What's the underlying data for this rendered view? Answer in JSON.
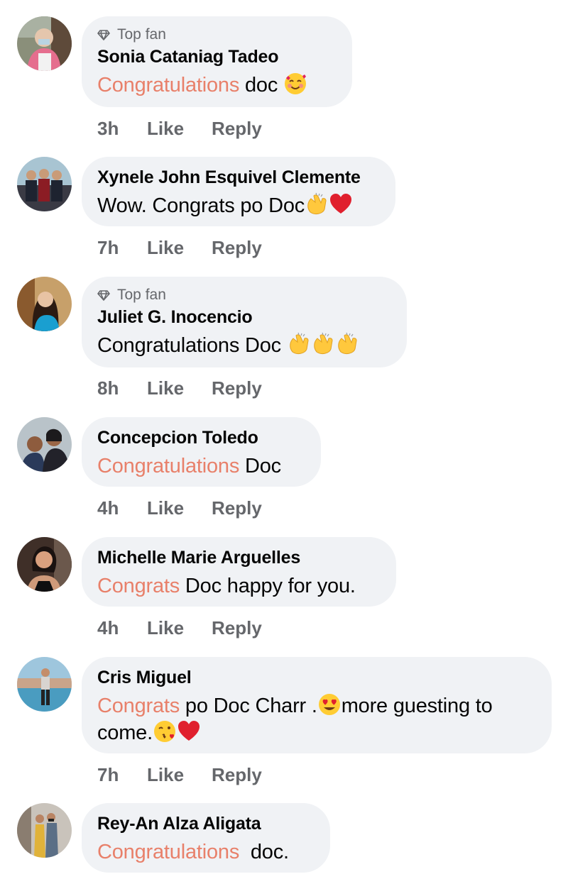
{
  "comments": [
    {
      "badge": "Top fan",
      "author": "Sonia Cataniag Tadeo",
      "highlight": "Congratulations",
      "text": " doc ",
      "emojis": [
        "smiling-face-with-hearts-emoji"
      ],
      "time": "3h",
      "like": "Like",
      "reply": "Reply"
    },
    {
      "author": "Xynele John Esquivel Clemente",
      "text": "Wow. Congrats po Doc",
      "emojis": [
        "clapping-hands-emoji",
        "red-heart-emoji"
      ],
      "time": "7h",
      "like": "Like",
      "reply": "Reply"
    },
    {
      "badge": "Top fan",
      "author": "Juliet G. Inocencio",
      "text": "Congratulations Doc ",
      "emojis": [
        "clapping-hands-emoji",
        "clapping-hands-emoji",
        "clapping-hands-emoji"
      ],
      "time": "8h",
      "like": "Like",
      "reply": "Reply"
    },
    {
      "author": "Concepcion Toledo",
      "highlight": "Congratulations",
      "text": " Doc",
      "time": "4h",
      "like": "Like",
      "reply": "Reply"
    },
    {
      "author": "Michelle Marie Arguelles",
      "highlight": "Congrats",
      "text": " Doc happy for you.",
      "time": "4h",
      "like": "Like",
      "reply": "Reply"
    },
    {
      "author": "Cris Miguel",
      "highlight": "Congrats",
      "text": " po Doc Charr .",
      "emoji_mid": "smiling-face-with-heart-eyes-emoji",
      "text2": "more guesting to",
      "text3": "come.",
      "emojis_end": [
        "face-blowing-kiss-emoji",
        "red-heart-emoji"
      ],
      "time": "7h",
      "like": "Like",
      "reply": "Reply"
    },
    {
      "author": "Rey-An Alza Aligata",
      "highlight": "Congratulations",
      "text": "  doc.",
      "time": "",
      "like": "",
      "reply": ""
    }
  ],
  "colors": {
    "bubble": "#f0f2f5",
    "highlight": "#e8806a",
    "meta": "#65676b",
    "text": "#050505"
  }
}
